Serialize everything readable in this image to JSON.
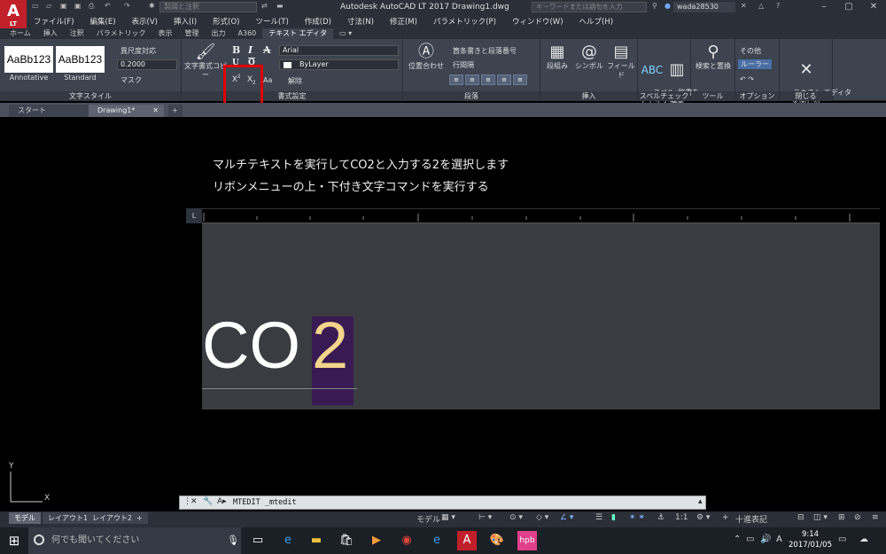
{
  "window": {
    "title": "Autodesk AutoCAD LT 2017    Drawing1.dwg",
    "logo_letter": "A",
    "logo_sub": "LT",
    "workspace": "製図と注釈",
    "search_placeholder": "キーワードまたは語句を入力",
    "user": "wada28530"
  },
  "menu": [
    "ファイル(F)",
    "編集(E)",
    "表示(V)",
    "挿入(I)",
    "形式(O)",
    "ツール(T)",
    "作成(D)",
    "寸法(N)",
    "修正(M)",
    "パラメトリック(P)",
    "ウィンドウ(W)",
    "ヘルプ(H)"
  ],
  "ribbon_tabs": [
    "ホーム",
    "挿入",
    "注釈",
    "パラメトリック",
    "表示",
    "管理",
    "出力",
    "A360",
    "テキスト エディタ"
  ],
  "ribbon": {
    "style_panel": {
      "title": "文字スタイル",
      "swatch1": "AaBb123",
      "swatch1_label": "Annotative",
      "swatch2": "AaBb123",
      "swatch2_label": "Standard",
      "annotative": "異尺度対応",
      "height": "0.2000",
      "mask": "マスク"
    },
    "format_panel": {
      "title": "書式設定",
      "copy_format": "文字書式コピー",
      "bold": "B",
      "italic": "I",
      "strike": "A",
      "underline": "U",
      "overline": "O",
      "superscript": "X",
      "subscript": "X",
      "case": "Aa",
      "font": "Arial",
      "color": "ByLayer",
      "clear": "解除"
    },
    "paragraph_panel": {
      "title": "段落",
      "justify": "位置合わせ",
      "bullets": "箇条書きと段落番号",
      "line_spacing": "行間隔"
    },
    "insert_panel": {
      "title": "挿入",
      "columns": "段組み",
      "symbol": "シンボル",
      "field": "フィールド"
    },
    "spell_panel": {
      "title": "スペルチェック",
      "spell": "スペル\nチェック",
      "dict": "辞書を\n編集"
    },
    "tools_panel": {
      "title": "ツール",
      "find": "検索と置換"
    },
    "options_panel": {
      "title": "オプション",
      "more": "その他",
      "ruler": "ルーラー"
    },
    "close_panel": {
      "title": "閉じる",
      "close": "テキスト エディタ\nを閉じる"
    }
  },
  "file_tabs": {
    "start": "スタート",
    "drawing": "Drawing1*"
  },
  "drawing": {
    "line1": "マルチテキストを実行してCO2と入力する2を選択します",
    "line2": "リボンメニューの上・下付き文字コマンドを実行する",
    "text_main": "CO",
    "text_selected": "2"
  },
  "command_line": {
    "text": "MTEDIT _mtedit"
  },
  "layout_tabs": [
    "モデル",
    "レイアウト1",
    "レイアウト2"
  ],
  "status": {
    "model": "モデル",
    "scale": "1:1",
    "units": "十進表記"
  },
  "taskbar": {
    "search": "何でも聞いてください",
    "time": "9:14",
    "date": "2017/01/05",
    "ime": "A"
  },
  "colors": {
    "highlight_box": "#e00000",
    "selection_bg": "#3a1a52",
    "selected_text": "#f3d58c",
    "ribbon_bg": "#3d434f"
  }
}
